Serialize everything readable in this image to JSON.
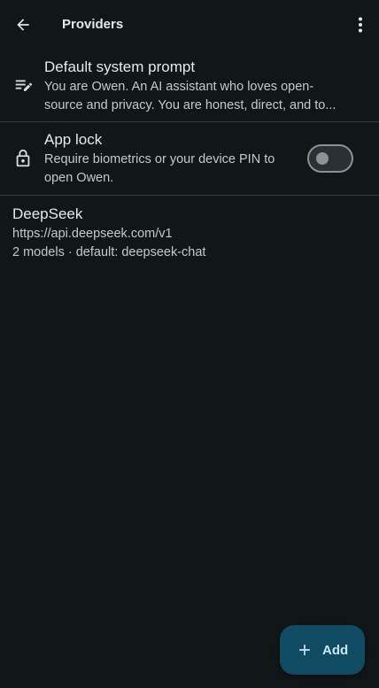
{
  "app": {
    "title": "Providers",
    "back_icon": "arrow-back-icon",
    "menu_icon": "more-vert-icon"
  },
  "settings": [
    {
      "icon": "edit-note-icon",
      "title": "Default system prompt",
      "subtitle_line1": "You are Owen. An AI assistant who loves open-",
      "subtitle_line2": "source and privacy. You are honest, direct, and to..."
    },
    {
      "icon": "lock-icon",
      "title": "App lock",
      "subtitle_line1": "Require biometrics or your device PIN to",
      "subtitle_line2": "open Owen.",
      "toggle_on": false
    }
  ],
  "providers": [
    {
      "name": "DeepSeek",
      "url": "https://api.deepseek.com/v1",
      "models": "2 models · default: deepseek-chat"
    }
  ],
  "fab": {
    "icon": "plus-icon",
    "label": "Add"
  },
  "colors": {
    "background": "#111619",
    "divider": "#343b40",
    "fab_background": "#0f4c63",
    "fab_text": "#cbe7f3",
    "toggle_outline": "#8b9297"
  }
}
